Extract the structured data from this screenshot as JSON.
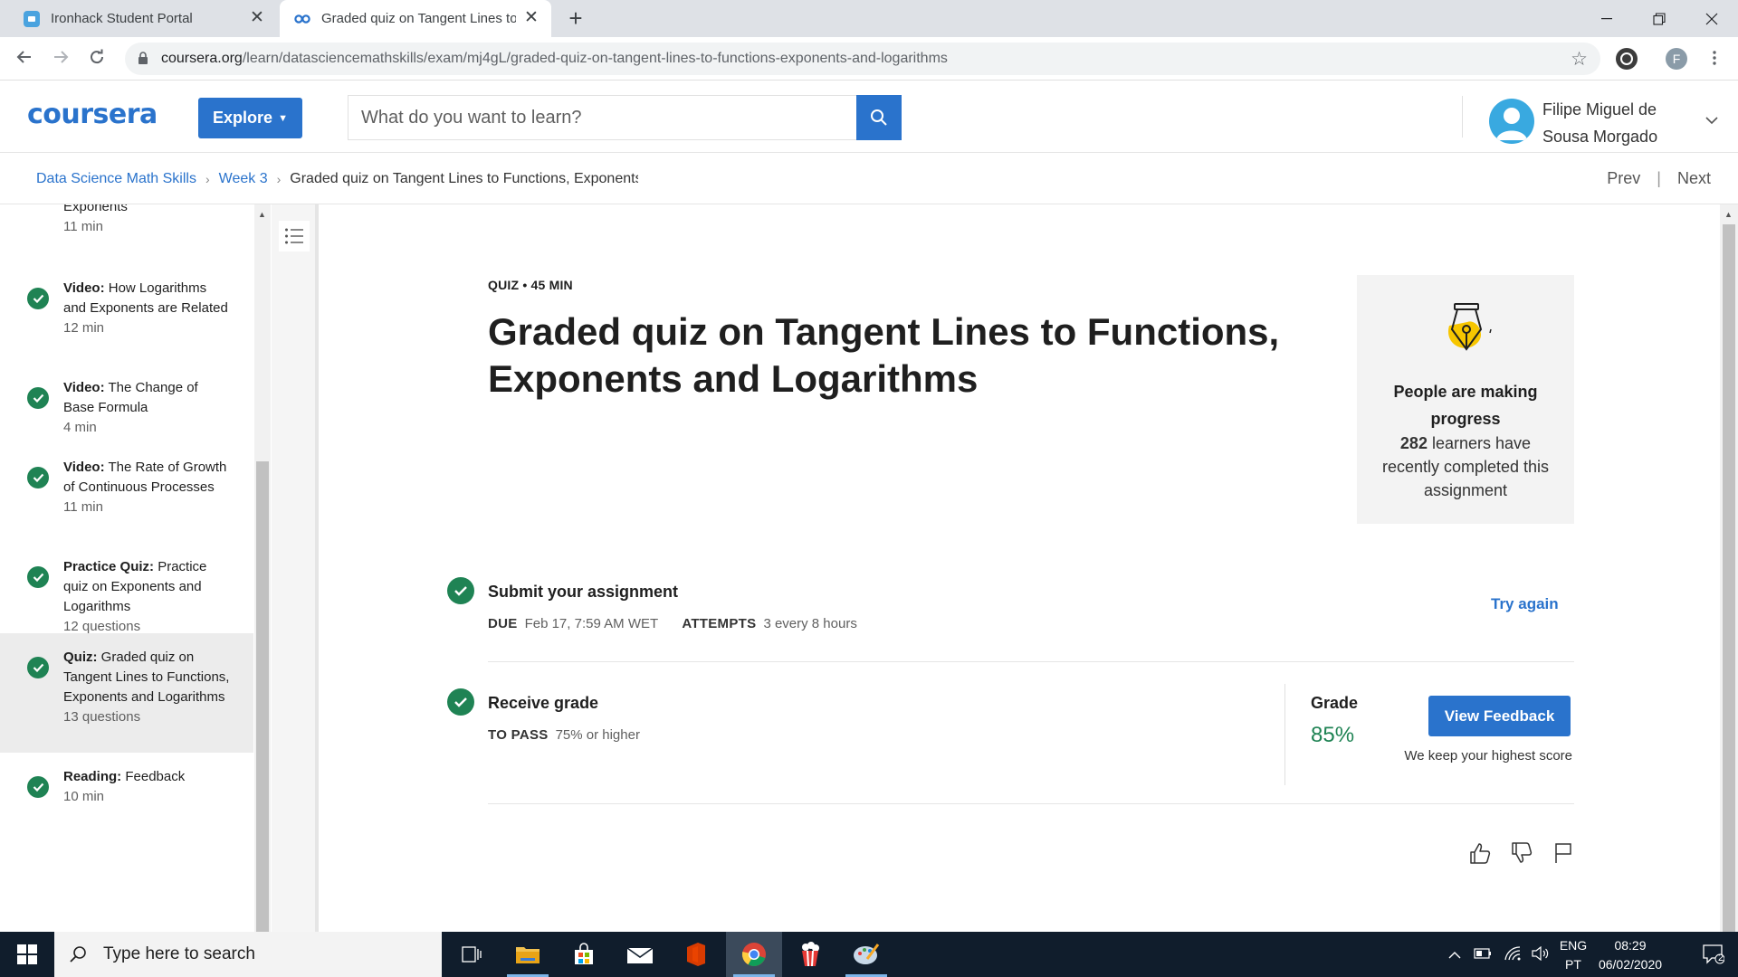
{
  "browser": {
    "tabs": [
      {
        "title": "Ironhack Student Portal"
      },
      {
        "title": "Graded quiz on Tangent Lines to"
      }
    ],
    "url_host": "coursera.org",
    "url_path": "/learn/datasciencemathskills/exam/mj4gL/graded-quiz-on-tangent-lines-to-functions-exponents-and-logarithms",
    "profile_initial": "F"
  },
  "header": {
    "logo": "coursera",
    "explore_label": "Explore",
    "search_placeholder": "What do you want to learn?",
    "user_name": "Filipe Miguel de Sousa Morgado"
  },
  "breadcrumb": {
    "course": "Data Science Math Skills",
    "week": "Week 3",
    "current": "Graded quiz on Tangent Lines to Functions, Exponents",
    "prev": "Prev",
    "next": "Next"
  },
  "sidebar": {
    "items": [
      {
        "type": "",
        "title": "Exponents",
        "meta": "11 min",
        "completed": false,
        "active": false
      },
      {
        "type": "Video:",
        "title": "How Logarithms and Exponents are Related",
        "meta": "12 min",
        "completed": true,
        "active": false
      },
      {
        "type": "Video:",
        "title": "The Change of Base Formula",
        "meta": "4 min",
        "completed": true,
        "active": false
      },
      {
        "type": "Video:",
        "title": "The Rate of Growth of Continuous Processes",
        "meta": "11 min",
        "completed": true,
        "active": false
      },
      {
        "type": "Practice Quiz:",
        "title": "Practice quiz on Exponents and Logarithms",
        "meta": "12 questions",
        "completed": true,
        "active": false
      },
      {
        "type": "Quiz:",
        "title": "Graded quiz on Tangent Lines to Functions, Exponents and Logarithms",
        "meta": "13 questions",
        "completed": true,
        "active": true
      },
      {
        "type": "Reading:",
        "title": "Feedback",
        "meta": "10 min",
        "completed": true,
        "active": false
      }
    ]
  },
  "main": {
    "quiz_label": "QUIZ • 45 MIN",
    "title": "Graded quiz on Tangent Lines to Functions, Exponents and Logarithms",
    "progress_card": {
      "title": "People are making progress",
      "count": "282",
      "text": "learners have recently completed this assignment"
    },
    "submit": {
      "title": "Submit your assignment",
      "due_key": "DUE",
      "due_value": "Feb 17, 7:59 AM WET",
      "attempts_key": "ATTEMPTS",
      "attempts_value": "3 every 8 hours",
      "try_again": "Try again"
    },
    "receive": {
      "title": "Receive grade",
      "pass_key": "TO PASS",
      "pass_value": "75% or higher",
      "grade_label": "Grade",
      "grade_value": "85%",
      "view_feedback": "View Feedback",
      "highest_note": "We keep your highest score"
    }
  },
  "taskbar": {
    "search_placeholder": "Type here to search",
    "lang_top": "ENG",
    "lang_bottom": "PT",
    "time": "08:29",
    "date": "06/02/2020",
    "notif_count": "2"
  },
  "colors": {
    "brand_blue": "#2a73cc",
    "success_green": "#1f8354"
  }
}
